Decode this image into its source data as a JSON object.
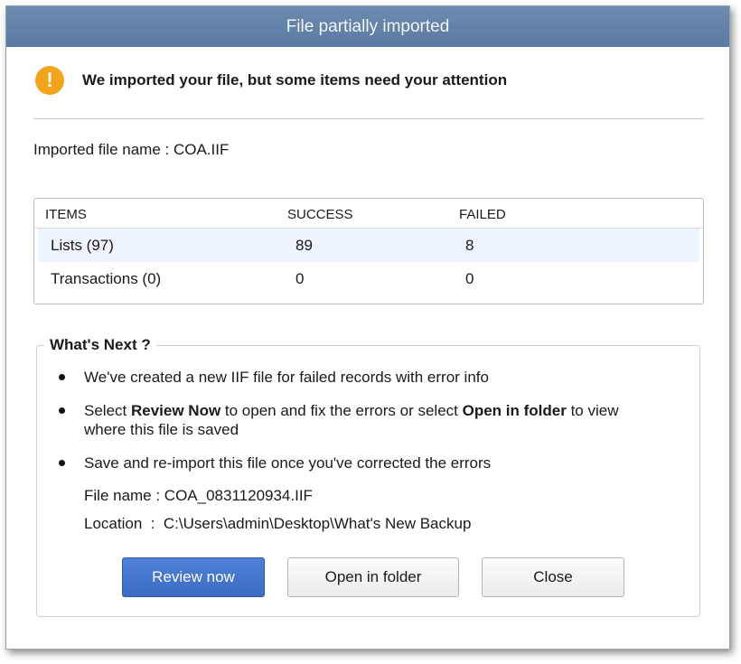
{
  "dialog": {
    "title": "File partially imported",
    "header_icon": "warning-icon",
    "header_text": "We imported your file, but some items need your attention",
    "imported_file_label": "Imported file name : COA.IIF"
  },
  "table": {
    "columns": [
      "ITEMS",
      "SUCCESS",
      "FAILED"
    ],
    "rows": [
      {
        "item": "Lists (97)",
        "success": "89",
        "failed": "8"
      },
      {
        "item": "Transactions (0)",
        "success": "0",
        "failed": "0"
      }
    ]
  },
  "whats_next": {
    "title": "What's Next ?",
    "bullet1": "We've created a new IIF file for failed records with error info",
    "bullet2": {
      "part1": "Select ",
      "bold1": "Review Now",
      "part2": " to open and fix the errors or select ",
      "bold2": "Open in folder",
      "part3": " to view where this file is saved"
    },
    "bullet3": "Save and re-import this file once you've corrected the errors",
    "file_name": "File name : COA_0831120934.IIF",
    "location": "Location  :  C:\\Users\\admin\\Desktop\\What's New Backup"
  },
  "buttons": {
    "review": "Review now",
    "open_folder": "Open in folder",
    "close": "Close"
  },
  "colors": {
    "title_bar": "#5f7ea6",
    "warning": "#f2a51c",
    "primary_button": "#4575cc"
  }
}
